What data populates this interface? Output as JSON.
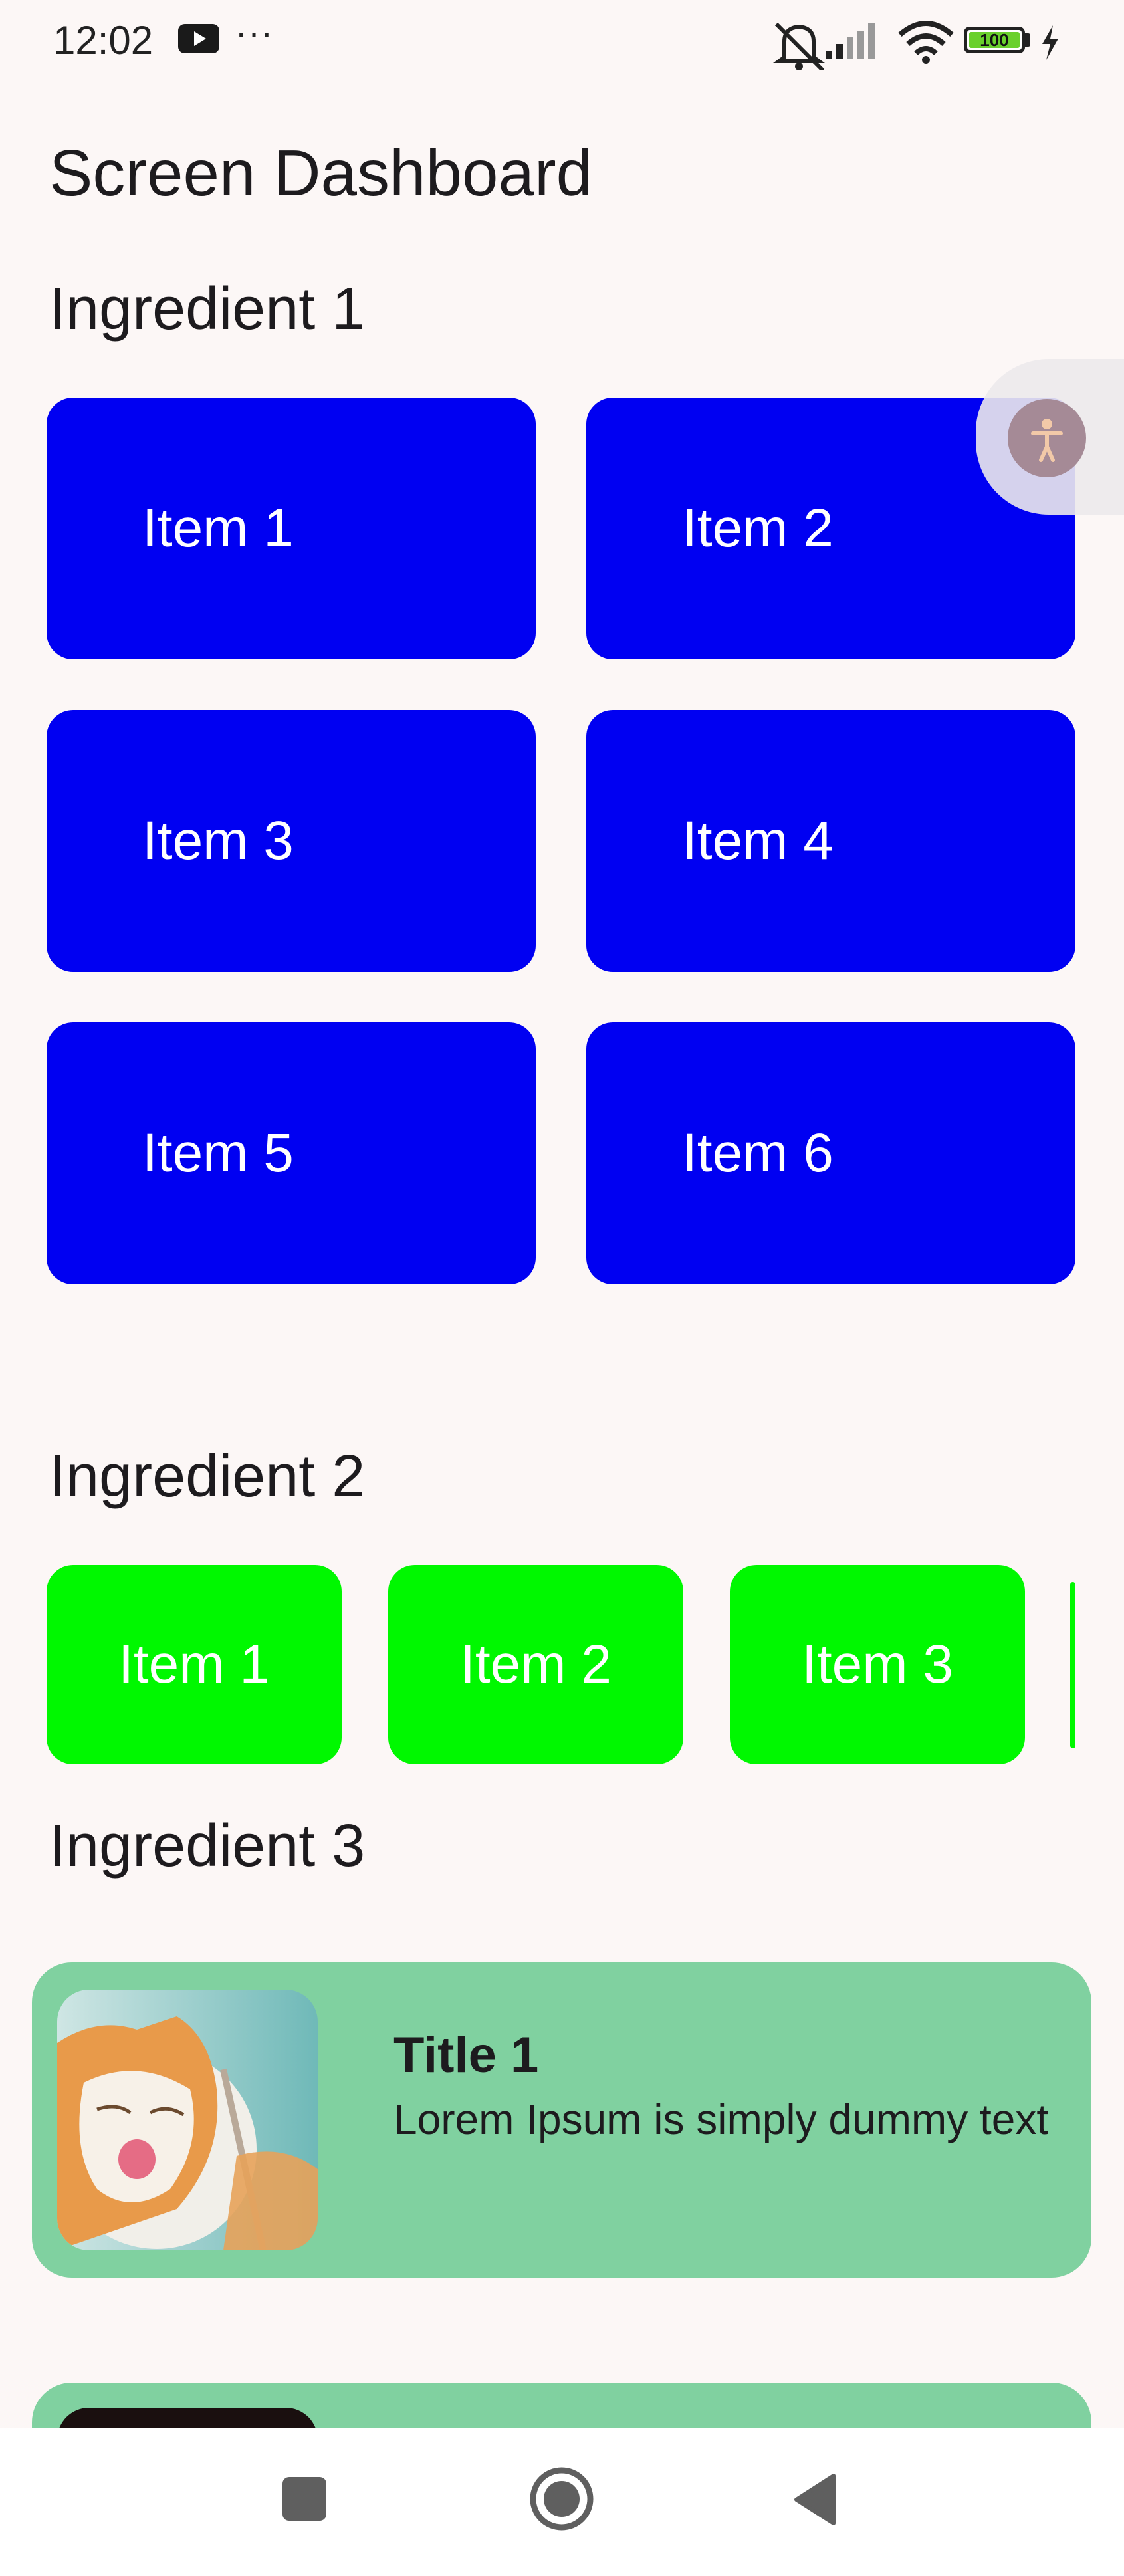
{
  "status_bar": {
    "time": "12:02",
    "battery": "100",
    "icons": [
      "youtube-icon",
      "more-icon",
      "bell-off-icon",
      "signal-icon",
      "wifi-icon",
      "battery-icon",
      "charging-icon"
    ]
  },
  "page": {
    "title": "Screen Dashboard"
  },
  "section1": {
    "title": "Ingredient 1",
    "color": "#0000f2",
    "items": [
      "Item 1",
      "Item 2",
      "Item 3",
      "Item 4",
      "Item 5",
      "Item 6"
    ]
  },
  "section2": {
    "title": "Ingredient 2",
    "color": "#00f800",
    "items": [
      "Item 1",
      "Item 2",
      "Item 3"
    ]
  },
  "section3": {
    "title": "Ingredient 3",
    "card_color": "#80d1a0",
    "cards": [
      {
        "title": "Title 1",
        "text": "Lorem Ipsum is simply dummy text",
        "image": "cat-photo"
      }
    ]
  },
  "accessibility": {
    "icon": "accessibility-icon"
  },
  "nav_bar": {
    "icons": [
      "recents-square-icon",
      "home-circle-icon",
      "back-triangle-icon"
    ]
  }
}
